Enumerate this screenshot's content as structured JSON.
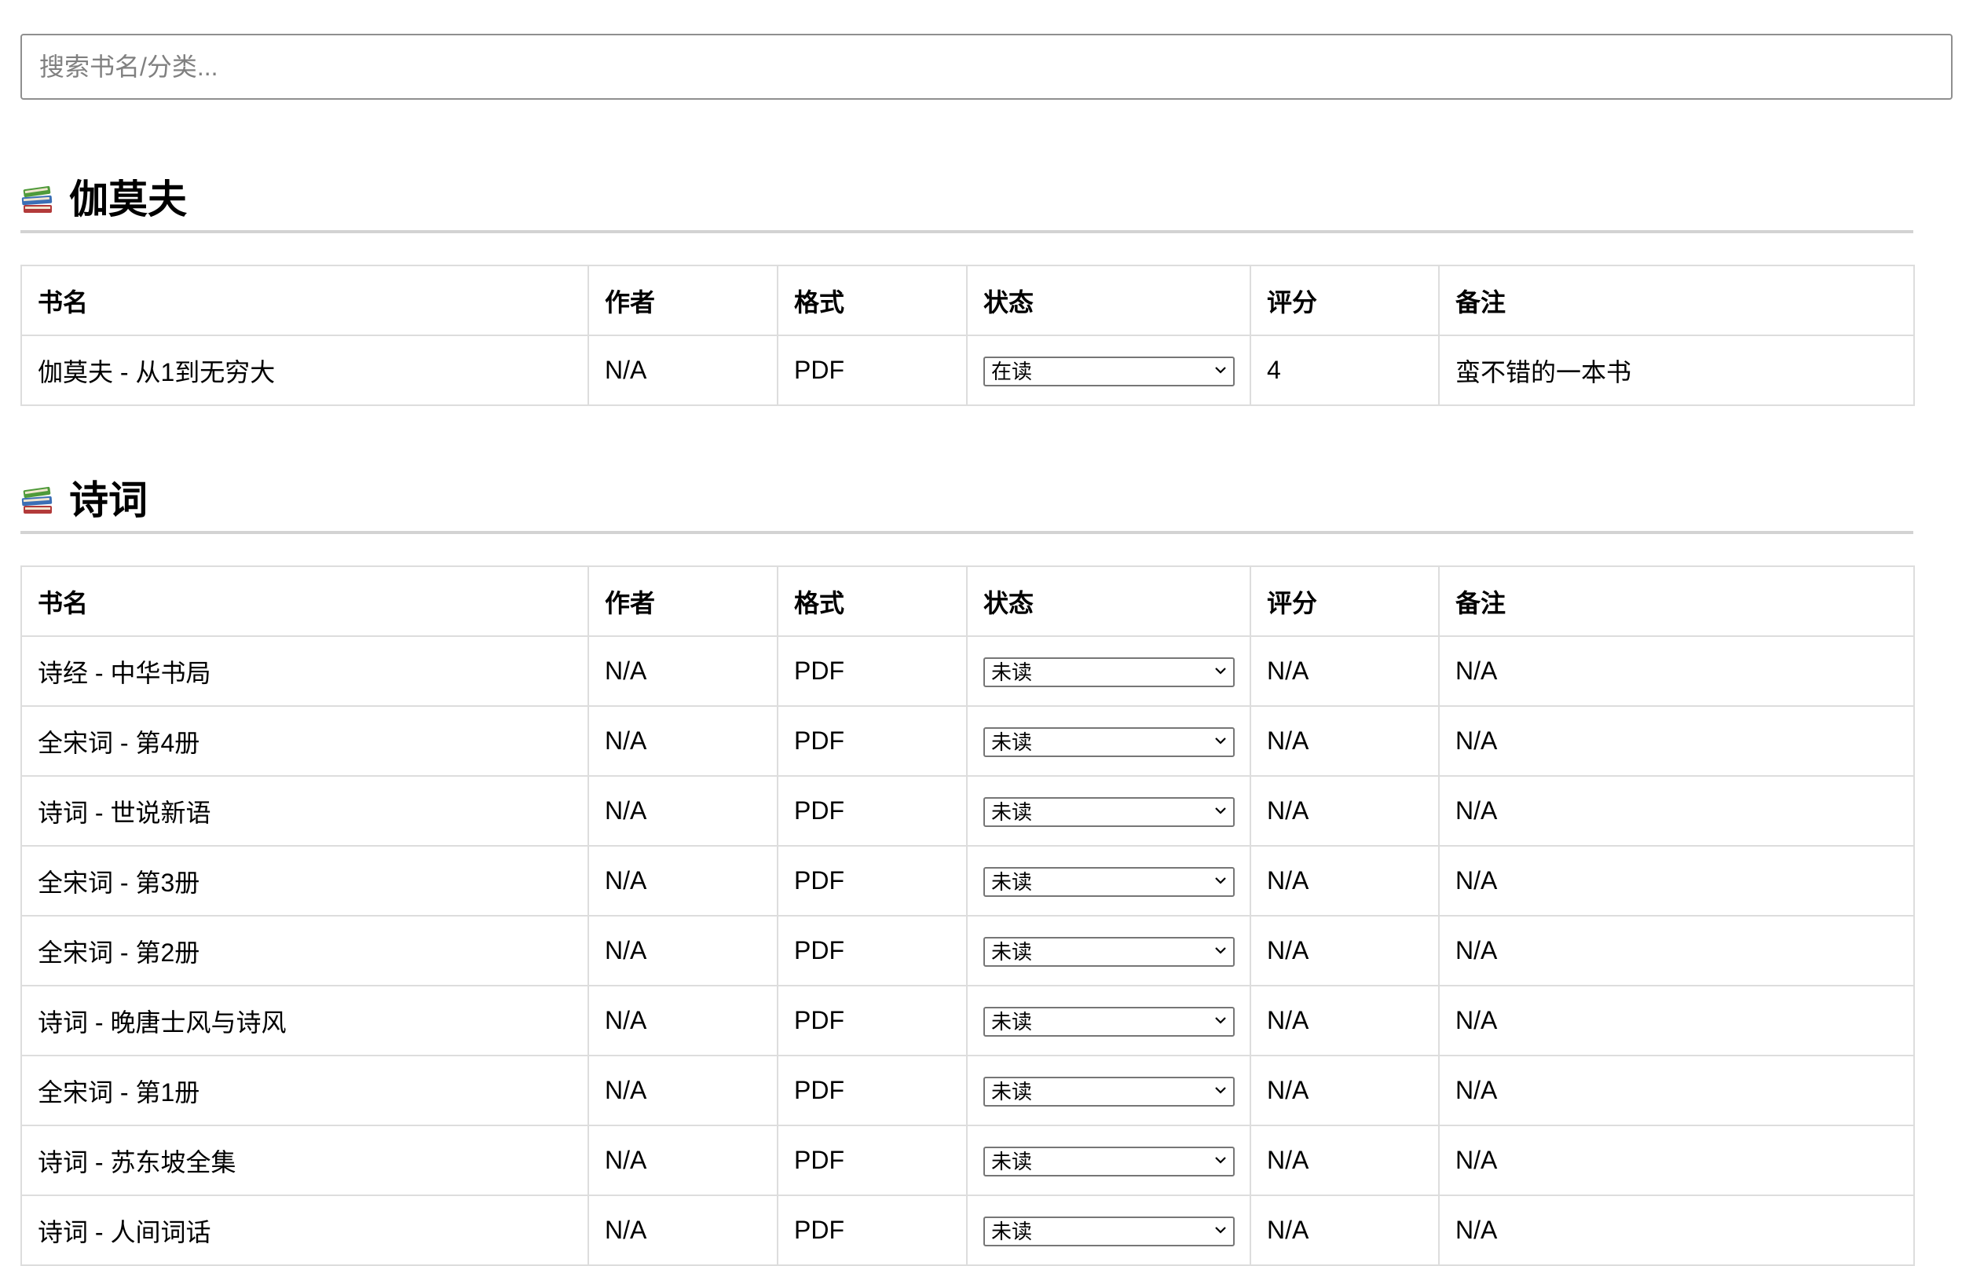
{
  "search": {
    "placeholder": "搜索书名/分类...",
    "value": ""
  },
  "table_headers": {
    "title": "书名",
    "author": "作者",
    "format": "格式",
    "status": "状态",
    "rating": "评分",
    "note": "备注"
  },
  "status_options": [
    "未读",
    "在读"
  ],
  "icons": {
    "category": "books-icon",
    "select": "chevron-down-icon"
  },
  "categories": [
    {
      "name": "伽莫夫",
      "books": [
        {
          "title": "伽莫夫 - 从1到无穷大",
          "author": "N/A",
          "format": "PDF",
          "status": "在读",
          "rating": "4",
          "note": "蛮不错的一本书"
        }
      ]
    },
    {
      "name": "诗词",
      "books": [
        {
          "title": "诗经 - 中华书局",
          "author": "N/A",
          "format": "PDF",
          "status": "未读",
          "rating": "N/A",
          "note": "N/A"
        },
        {
          "title": "全宋词 - 第4册",
          "author": "N/A",
          "format": "PDF",
          "status": "未读",
          "rating": "N/A",
          "note": "N/A"
        },
        {
          "title": "诗词 - 世说新语",
          "author": "N/A",
          "format": "PDF",
          "status": "未读",
          "rating": "N/A",
          "note": "N/A"
        },
        {
          "title": "全宋词 - 第3册",
          "author": "N/A",
          "format": "PDF",
          "status": "未读",
          "rating": "N/A",
          "note": "N/A"
        },
        {
          "title": "全宋词 - 第2册",
          "author": "N/A",
          "format": "PDF",
          "status": "未读",
          "rating": "N/A",
          "note": "N/A"
        },
        {
          "title": "诗词 - 晚唐士风与诗风",
          "author": "N/A",
          "format": "PDF",
          "status": "未读",
          "rating": "N/A",
          "note": "N/A"
        },
        {
          "title": "全宋词 - 第1册",
          "author": "N/A",
          "format": "PDF",
          "status": "未读",
          "rating": "N/A",
          "note": "N/A"
        },
        {
          "title": "诗词 - 苏东坡全集",
          "author": "N/A",
          "format": "PDF",
          "status": "未读",
          "rating": "N/A",
          "note": "N/A"
        },
        {
          "title": "诗词 - 人间词话",
          "author": "N/A",
          "format": "PDF",
          "status": "未读",
          "rating": "N/A",
          "note": "N/A"
        }
      ]
    }
  ]
}
